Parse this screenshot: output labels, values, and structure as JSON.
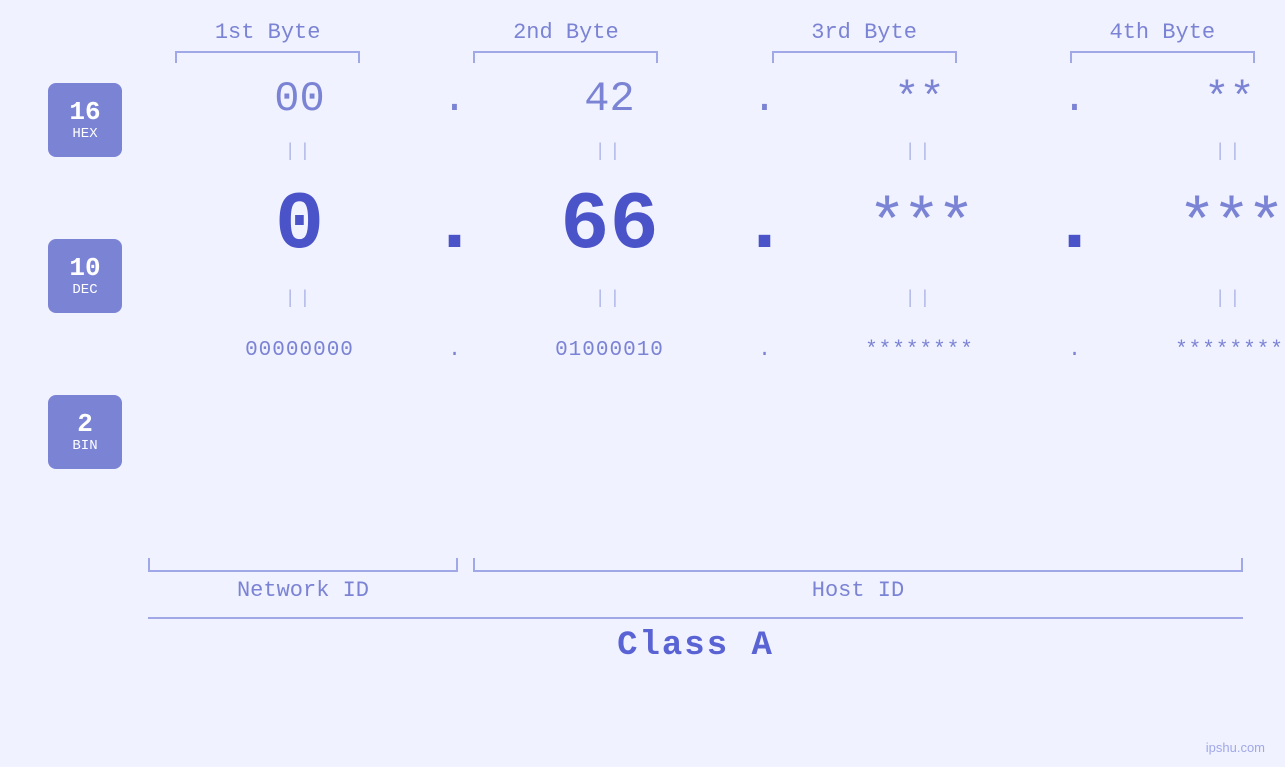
{
  "page": {
    "background": "#f0f2ff",
    "watermark": "ipshu.com"
  },
  "header": {
    "bytes": [
      {
        "label": "1st Byte"
      },
      {
        "label": "2nd Byte"
      },
      {
        "label": "3rd Byte"
      },
      {
        "label": "4th Byte"
      }
    ]
  },
  "badges": [
    {
      "num": "16",
      "label": "HEX"
    },
    {
      "num": "10",
      "label": "DEC"
    },
    {
      "num": "2",
      "label": "BIN"
    }
  ],
  "bytes": [
    {
      "hex": "00",
      "dec": "0",
      "bin": "00000000",
      "known": true
    },
    {
      "hex": "42",
      "dec": "66",
      "bin": "01000010",
      "known": true
    },
    {
      "hex": "**",
      "dec": "***",
      "bin": "********",
      "known": false
    },
    {
      "hex": "**",
      "dec": "***",
      "bin": "********",
      "known": false
    }
  ],
  "separators": [
    ".",
    ".",
    ".",
    ""
  ],
  "labels": {
    "network_id": "Network ID",
    "host_id": "Host ID",
    "class": "Class A"
  }
}
